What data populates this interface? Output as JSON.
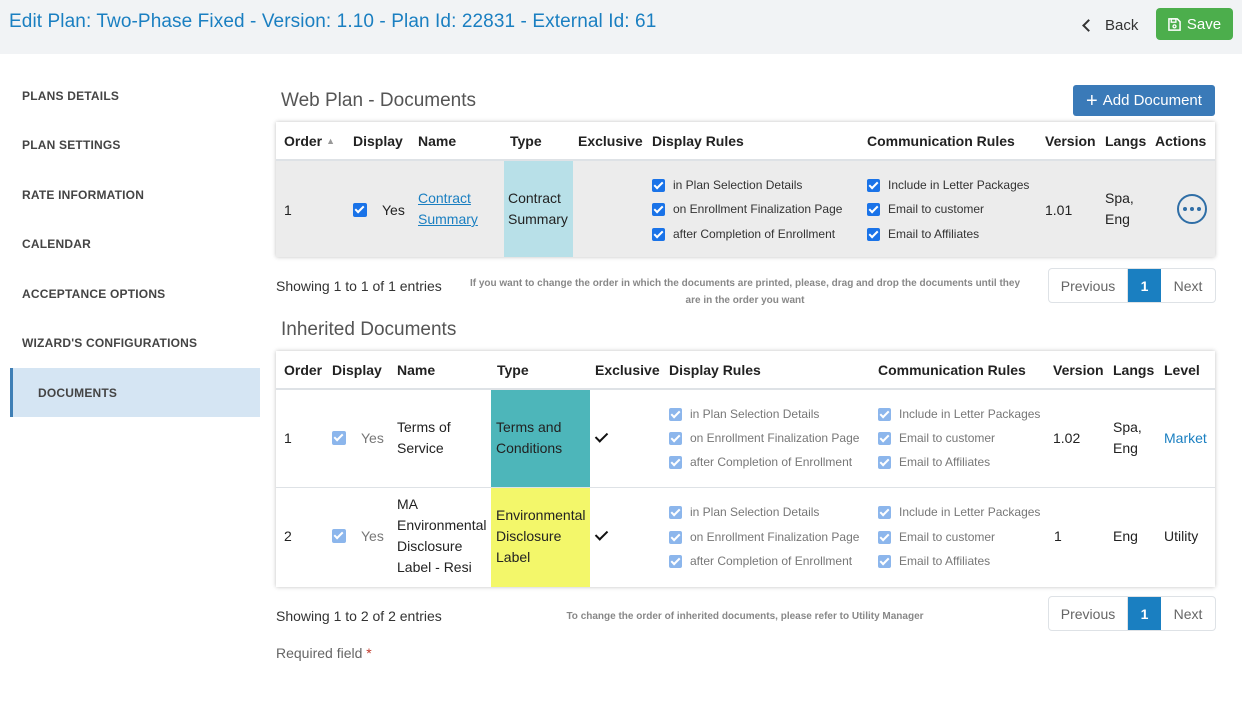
{
  "header": {
    "title": "Edit Plan: Two-Phase Fixed - Version: 1.10 - Plan Id: 22831 - External Id: 61",
    "back_label": "Back",
    "save_label": "Save"
  },
  "sidebar": {
    "items": [
      {
        "label": "PLANS DETAILS"
      },
      {
        "label": "PLAN SETTINGS"
      },
      {
        "label": "RATE INFORMATION"
      },
      {
        "label": "CALENDAR"
      },
      {
        "label": "ACCEPTANCE OPTIONS"
      },
      {
        "label": "WIZARD'S CONFIGURATIONS"
      },
      {
        "label": "DOCUMENTS",
        "active": true
      }
    ]
  },
  "web_documents": {
    "title": "Web Plan - Documents",
    "add_button": "Add Document",
    "columns": [
      "Order",
      "Display",
      "Name",
      "Type",
      "Exclusive",
      "Display Rules",
      "Communication Rules",
      "Version",
      "Langs",
      "Actions"
    ],
    "rows": [
      {
        "order": "1",
        "display": "Yes",
        "name_line1": "Contract",
        "name_line2": "Summary",
        "type_line1": "Contract",
        "type_line2": "Summary",
        "type_color": "#b8e0e8",
        "display_rules": [
          "in Plan Selection Details",
          "on Enrollment Finalization Page",
          "after Completion of Enrollment"
        ],
        "communication_rules": [
          "Include in Letter Packages",
          "Email to customer",
          "Email to Affiliates"
        ],
        "version": "1.01",
        "langs_line1": "Spa,",
        "langs_line2": "Eng"
      }
    ],
    "showing": "Showing 1 to 1 of 1 entries",
    "hint_line1": "If you want to change the order in which the documents are printed, please, drag and drop the documents until they",
    "hint_line2": "are in the order you want",
    "pager": {
      "previous": "Previous",
      "page": "1",
      "next": "Next"
    }
  },
  "inherited_documents": {
    "title": "Inherited Documents",
    "columns": [
      "Order",
      "Display",
      "Name",
      "Type",
      "Exclusive",
      "Display Rules",
      "Communication Rules",
      "Version",
      "Langs",
      "Level"
    ],
    "rows": [
      {
        "order": "1",
        "display": "Yes",
        "name_lines": [
          "Terms of",
          "Service"
        ],
        "type_lines": [
          "Terms and",
          "Conditions"
        ],
        "type_color": "#4db6ba",
        "display_rules": [
          "in Plan Selection Details",
          "on Enrollment Finalization Page",
          "after Completion of Enrollment"
        ],
        "communication_rules": [
          "Include in Letter Packages",
          "Email to customer",
          "Email to Affiliates"
        ],
        "version": "1.02",
        "langs_line1": "Spa,",
        "langs_line2": "Eng",
        "level": "Market"
      },
      {
        "order": "2",
        "display": "Yes",
        "name_lines": [
          "MA",
          "Environmental",
          "Disclosure",
          "Label - Resi"
        ],
        "type_lines": [
          "Environmental",
          "Disclosure",
          "Label"
        ],
        "type_color": "#f3f76a",
        "display_rules": [
          "in Plan Selection Details",
          "on Enrollment Finalization Page",
          "after Completion of Enrollment"
        ],
        "communication_rules": [
          "Include in Letter Packages",
          "Email to customer",
          "Email to Affiliates"
        ],
        "version": "1",
        "langs_line1": "Eng",
        "level": "Utility"
      }
    ],
    "showing": "Showing 1 to 2 of 2 entries",
    "hint": "To change the order of inherited documents, please refer to Utility Manager",
    "pager": {
      "previous": "Previous",
      "page": "1",
      "next": "Next"
    }
  },
  "required_label": "Required field",
  "required_mark": "*"
}
